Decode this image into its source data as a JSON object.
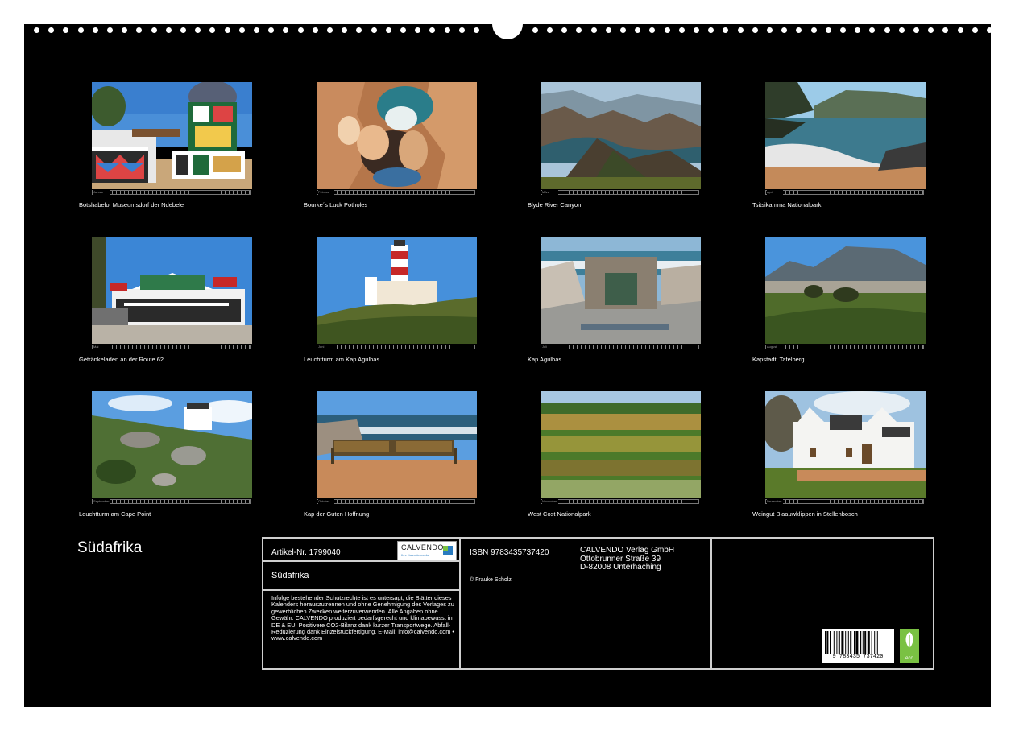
{
  "calendar": {
    "title": "Südafrika",
    "months": [
      {
        "label": "Botshabelo: Museumsdorf der Ndebele",
        "short": "Januar"
      },
      {
        "label": "Bourke´s Luck Potholes",
        "short": "Februar"
      },
      {
        "label": "Blyde River Canyon",
        "short": "März"
      },
      {
        "label": "Tsitsikamma Nationalpark",
        "short": "April"
      },
      {
        "label": "Getränkeladen an der Route 62",
        "short": "Mai"
      },
      {
        "label": "Leuchtturm am Kap Agulhas",
        "short": "Juni"
      },
      {
        "label": "Kap Agulhas",
        "short": "Juli"
      },
      {
        "label": "Kapstadt: Tafelberg",
        "short": "August"
      },
      {
        "label": "Leuchtturm am Cape Point",
        "short": "September"
      },
      {
        "label": "Kap der Guten Hoffnung",
        "short": "Oktober"
      },
      {
        "label": "West Cost Nationalpark",
        "short": "November"
      },
      {
        "label": "Weingut Blaauwklippen in Stellenbosch",
        "short": "Dezember"
      }
    ]
  },
  "info": {
    "article": "Artikel-Nr. 1799040",
    "logo_text": "CALVENDO",
    "logo_sub": "Ihre Kalendermarke",
    "subtitle": "Südafrika",
    "legal": "Infolge bestehender Schutzrechte ist es untersagt, die Blätter dieses Kalenders herauszutrennen und ohne Genehmigung des Verlages zu gewerblichen Zwecken weiterzuverwenden. Alle Angaben ohne Gewähr. CALVENDO produziert bedarfsgerecht und klimabewusst in DE & EU. Positivere CO2-Bilanz dank kurzer Transportwege. Abfall-Reduzierung dank Einzelstückfertigung. E-Mail: info@calvendo.com • www.calvendo.com",
    "isbn": "ISBN 9783435737420",
    "copyright": "© Frauke Scholz",
    "publisher_line1": "CALVENDO Verlag GmbH",
    "publisher_line2": "Ottobrunner Straße 39",
    "publisher_line3": "D-82008 Unterhaching",
    "barcode_number": "9 783435 737420",
    "eco_label": "eco"
  }
}
